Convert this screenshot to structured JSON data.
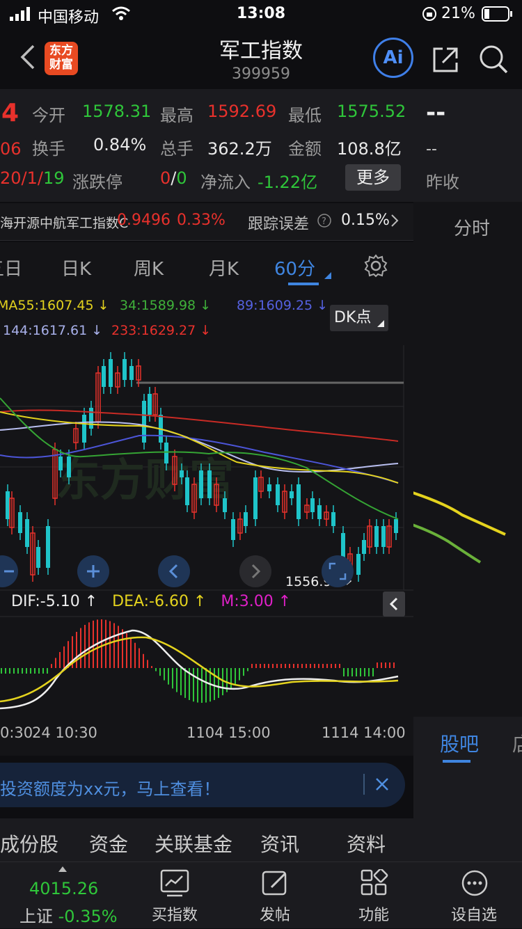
{
  "status": {
    "carrier": "中国移动",
    "time": "13:08",
    "battery": "21%"
  },
  "header": {
    "logo_line1": "东方",
    "logo_line2": "财富",
    "title": "军工指数",
    "code": "399959",
    "ai_label": "Ai"
  },
  "quote": {
    "last_digit": "4",
    "last_frag": "06",
    "date_frag": "20/1/",
    "date_frag2": "19",
    "open_label": "今开",
    "open_value": "1578.31",
    "high_label": "最高",
    "high_value": "1592.69",
    "low_label": "最低",
    "low_value": "1575.52",
    "turnover_label": "换手",
    "turnover_value": "0.84%",
    "volume_label": "总手",
    "volume_value": "362.2万",
    "amount_label": "金额",
    "amount_value": "108.8亿",
    "limit_label": "涨跌停",
    "limit_up": "0",
    "limit_sep": "/",
    "limit_down": "0",
    "inflow_label": "净流入",
    "inflow_value": "-1.22亿",
    "more_button": "更多"
  },
  "right_panel": {
    "dash1": "--",
    "dash2": "--",
    "prev_close_label": "昨收",
    "tab_time": "分时",
    "tab_forum": "股吧",
    "tab_cut": "店"
  },
  "tracking": {
    "name": "海开源中航军工指数C",
    "price": "0.9496",
    "change": "0.33%",
    "error_label": "跟踪误差",
    "error_value": "0.15%"
  },
  "ktabs": [
    {
      "label": "五日",
      "active": false
    },
    {
      "label": "日K",
      "active": false
    },
    {
      "label": "周K",
      "active": false
    },
    {
      "label": "月K",
      "active": false
    },
    {
      "label": "60分",
      "active": true
    }
  ],
  "ma": {
    "ma55": "MA55:1607.45 ↓",
    "ma34": "34:1589.98 ↓",
    "ma89": "89:1609.25 ↓",
    "ma144": "144:1617.61 ↓",
    "ma233": "233:1629.27 ↓",
    "dk_button": "DK点"
  },
  "chart": {
    "min_label": "1556.90",
    "watermark": "东方财富",
    "macd_dif": "DIF:-5.10 ↑",
    "macd_dea": "DEA:-6.60 ↑",
    "macd_m": "M:3.00 ↑",
    "xaxis": [
      "0:30",
      "24 10:30",
      "1104 15:00",
      "1114 14:00"
    ]
  },
  "chart_data": {
    "type": "candlestick",
    "interval": "60分",
    "low_marker": 1556.9,
    "ma": {
      "MA55": 1607.45,
      "MA34": 1589.98,
      "MA89": 1609.25,
      "MA144": 1617.61,
      "MA233": 1629.27
    },
    "macd": {
      "DIF": -5.1,
      "DEA": -6.6,
      "M": 3.0
    }
  },
  "banner": {
    "text": "投资额度为xx元，马上查看！"
  },
  "subtabs": [
    "成份股",
    "资金",
    "关联基金",
    "资讯",
    "资料"
  ],
  "bottom": {
    "index_value": "4015.26",
    "index_name": "上证",
    "index_change": "-0.35%",
    "items": [
      "买指数",
      "发帖",
      "功能",
      "设自选"
    ]
  }
}
